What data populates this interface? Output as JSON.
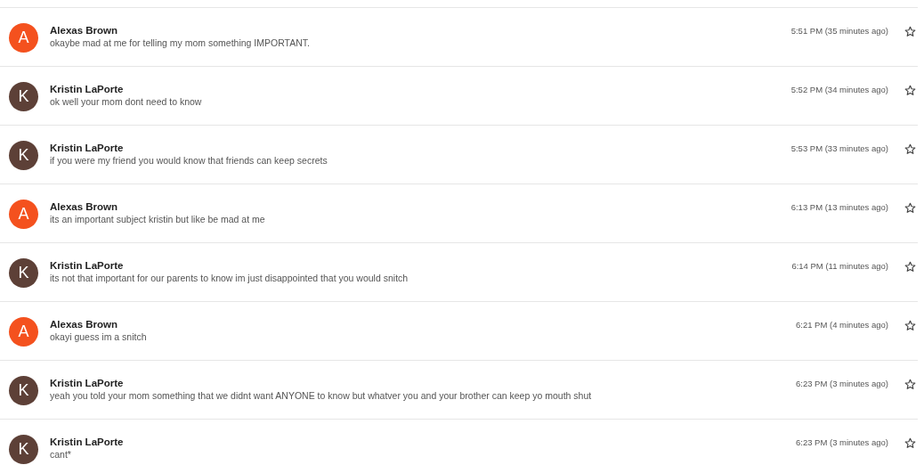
{
  "messages": [
    {
      "avatar": "A",
      "color": "#f4511e",
      "sender": "Alexas Brown",
      "text": "okaybe mad at me for telling my mom something IMPORTANT.",
      "time": "5:51 PM (35 minutes ago)",
      "starred": false
    },
    {
      "avatar": "K",
      "color": "#5d4037",
      "sender": "Kristin LaPorte",
      "text": "ok well your mom dont need to know",
      "time": "5:52 PM (34 minutes ago)",
      "starred": false
    },
    {
      "avatar": "K",
      "color": "#5d4037",
      "sender": "Kristin LaPorte",
      "text": "if you were my friend you would know that friends can keep secrets",
      "time": "5:53 PM (33 minutes ago)",
      "starred": false
    },
    {
      "avatar": "A",
      "color": "#f4511e",
      "sender": "Alexas Brown",
      "text": "its an important subject kristin but like be mad at me",
      "time": "6:13 PM (13 minutes ago)",
      "starred": false
    },
    {
      "avatar": "K",
      "color": "#5d4037",
      "sender": "Kristin LaPorte",
      "text": "its not that important for our parents to know im just disappointed that you would snitch",
      "time": "6:14 PM (11 minutes ago)",
      "starred": false
    },
    {
      "avatar": "A",
      "color": "#f4511e",
      "sender": "Alexas Brown",
      "text": "okayi guess im a snitch",
      "time": "6:21 PM (4 minutes ago)",
      "starred": false
    },
    {
      "avatar": "K",
      "color": "#5d4037",
      "sender": "Kristin LaPorte",
      "text": "yeah you told your mom something that we didnt want ANYONE to know but whatver you and your brother can keep yo mouth shut",
      "time": "6:23 PM (3 minutes ago)",
      "starred": false
    },
    {
      "avatar": "K",
      "color": "#5d4037",
      "sender": "Kristin LaPorte",
      "text": "cant*",
      "time": "6:23 PM (3 minutes ago)",
      "starred": false
    }
  ]
}
